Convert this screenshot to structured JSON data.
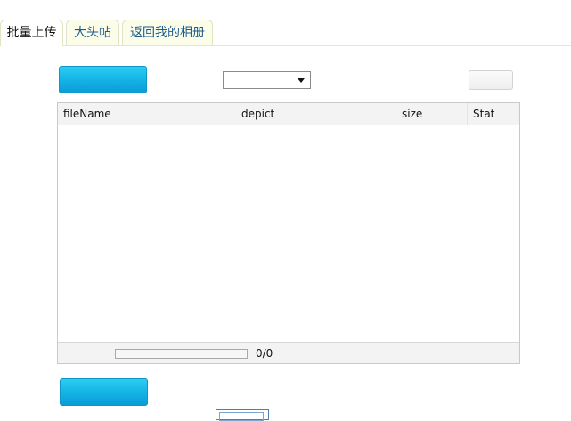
{
  "tabs": [
    {
      "label": "批量上传",
      "active": true
    },
    {
      "label": "大头帖",
      "active": false
    },
    {
      "label": "返回我的相册",
      "active": false
    }
  ],
  "toolbar": {
    "select_button_label": "",
    "album_select_value": "",
    "confirm_button_label": ""
  },
  "file_list": {
    "columns": [
      "fileName",
      "depict",
      "size",
      "Stat"
    ],
    "rows": []
  },
  "progress": {
    "fraction": 0,
    "text": "0/0"
  },
  "upload_button_label": "",
  "colors": {
    "accent": "#14b4e6",
    "tab_text": "#1a5b8c",
    "tab_bg": "#fbfde9"
  }
}
